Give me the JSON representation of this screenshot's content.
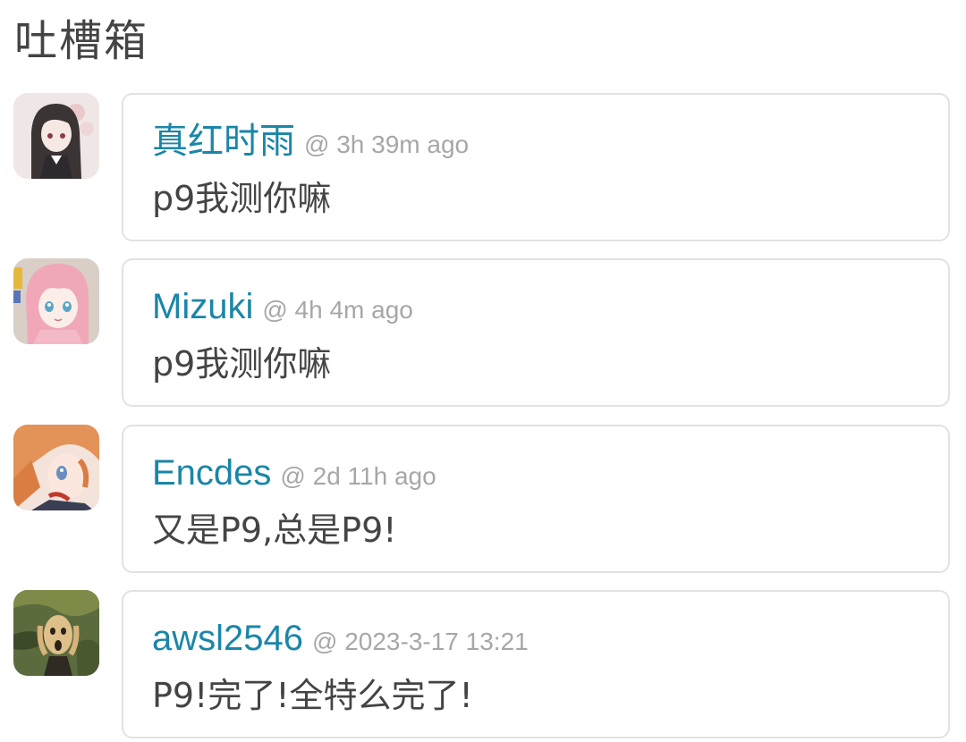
{
  "page": {
    "title": "吐槽箱"
  },
  "comments": [
    {
      "author": "真红时雨",
      "time": "@ 3h 39m ago",
      "text": "p9我测你嘛",
      "avatar_icon": "anime-girl-dark-hair-avatar"
    },
    {
      "author": "Mizuki",
      "time": "@ 4h 4m ago",
      "text": "p9我测你嘛",
      "avatar_icon": "anime-girl-pink-hair-avatar"
    },
    {
      "author": "Encdes",
      "time": "@ 2d 11h ago",
      "text": "又是P9,总是P9!",
      "avatar_icon": "anime-character-orange-hair-avatar"
    },
    {
      "author": "awsl2546",
      "time": "@ 2023-3-17 13:21",
      "text": "P9!完了!全特么完了!",
      "avatar_icon": "the-scream-painting-avatar"
    }
  ],
  "colors": {
    "author": "#1a86a8",
    "timestamp": "#a7a7a7",
    "text": "#444444",
    "border": "#e2e2e2"
  }
}
